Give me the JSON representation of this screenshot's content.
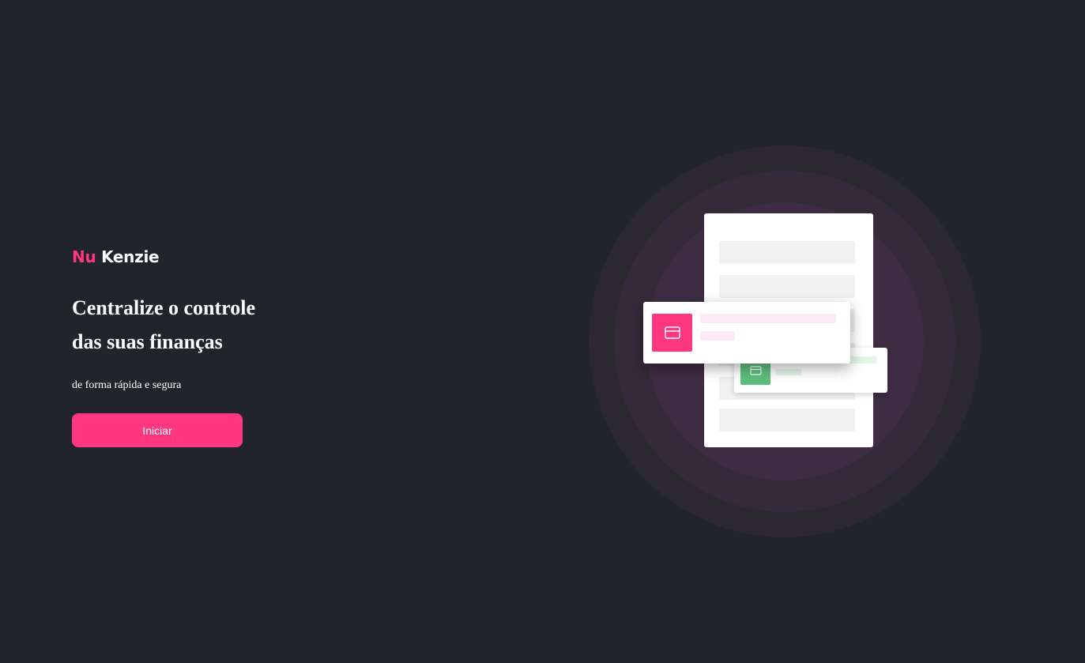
{
  "brand": {
    "logo_part1": "Nu",
    "logo_part2": "Kenzie",
    "primary_color": "#FF377F",
    "logo_part2_color": "#FFFFFF"
  },
  "hero": {
    "headline_line1": "Centralize o controle",
    "headline_line2": "das suas finanças",
    "tagline": "de forma rápida e segura",
    "button_label": "Iniciar"
  },
  "theme": {
    "background": "#212529",
    "income_color": "#5FBE7E",
    "card_icon": "credit-card-icon"
  }
}
